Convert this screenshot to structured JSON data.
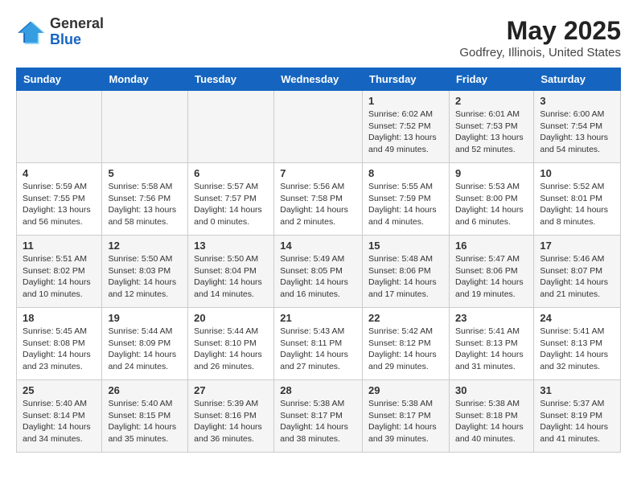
{
  "logo": {
    "general": "General",
    "blue": "Blue"
  },
  "title": "May 2025",
  "subtitle": "Godfrey, Illinois, United States",
  "days_of_week": [
    "Sunday",
    "Monday",
    "Tuesday",
    "Wednesday",
    "Thursday",
    "Friday",
    "Saturday"
  ],
  "weeks": [
    [
      {
        "num": "",
        "info": ""
      },
      {
        "num": "",
        "info": ""
      },
      {
        "num": "",
        "info": ""
      },
      {
        "num": "",
        "info": ""
      },
      {
        "num": "1",
        "info": "Sunrise: 6:02 AM\nSunset: 7:52 PM\nDaylight: 13 hours\nand 49 minutes."
      },
      {
        "num": "2",
        "info": "Sunrise: 6:01 AM\nSunset: 7:53 PM\nDaylight: 13 hours\nand 52 minutes."
      },
      {
        "num": "3",
        "info": "Sunrise: 6:00 AM\nSunset: 7:54 PM\nDaylight: 13 hours\nand 54 minutes."
      }
    ],
    [
      {
        "num": "4",
        "info": "Sunrise: 5:59 AM\nSunset: 7:55 PM\nDaylight: 13 hours\nand 56 minutes."
      },
      {
        "num": "5",
        "info": "Sunrise: 5:58 AM\nSunset: 7:56 PM\nDaylight: 13 hours\nand 58 minutes."
      },
      {
        "num": "6",
        "info": "Sunrise: 5:57 AM\nSunset: 7:57 PM\nDaylight: 14 hours\nand 0 minutes."
      },
      {
        "num": "7",
        "info": "Sunrise: 5:56 AM\nSunset: 7:58 PM\nDaylight: 14 hours\nand 2 minutes."
      },
      {
        "num": "8",
        "info": "Sunrise: 5:55 AM\nSunset: 7:59 PM\nDaylight: 14 hours\nand 4 minutes."
      },
      {
        "num": "9",
        "info": "Sunrise: 5:53 AM\nSunset: 8:00 PM\nDaylight: 14 hours\nand 6 minutes."
      },
      {
        "num": "10",
        "info": "Sunrise: 5:52 AM\nSunset: 8:01 PM\nDaylight: 14 hours\nand 8 minutes."
      }
    ],
    [
      {
        "num": "11",
        "info": "Sunrise: 5:51 AM\nSunset: 8:02 PM\nDaylight: 14 hours\nand 10 minutes."
      },
      {
        "num": "12",
        "info": "Sunrise: 5:50 AM\nSunset: 8:03 PM\nDaylight: 14 hours\nand 12 minutes."
      },
      {
        "num": "13",
        "info": "Sunrise: 5:50 AM\nSunset: 8:04 PM\nDaylight: 14 hours\nand 14 minutes."
      },
      {
        "num": "14",
        "info": "Sunrise: 5:49 AM\nSunset: 8:05 PM\nDaylight: 14 hours\nand 16 minutes."
      },
      {
        "num": "15",
        "info": "Sunrise: 5:48 AM\nSunset: 8:06 PM\nDaylight: 14 hours\nand 17 minutes."
      },
      {
        "num": "16",
        "info": "Sunrise: 5:47 AM\nSunset: 8:06 PM\nDaylight: 14 hours\nand 19 minutes."
      },
      {
        "num": "17",
        "info": "Sunrise: 5:46 AM\nSunset: 8:07 PM\nDaylight: 14 hours\nand 21 minutes."
      }
    ],
    [
      {
        "num": "18",
        "info": "Sunrise: 5:45 AM\nSunset: 8:08 PM\nDaylight: 14 hours\nand 23 minutes."
      },
      {
        "num": "19",
        "info": "Sunrise: 5:44 AM\nSunset: 8:09 PM\nDaylight: 14 hours\nand 24 minutes."
      },
      {
        "num": "20",
        "info": "Sunrise: 5:44 AM\nSunset: 8:10 PM\nDaylight: 14 hours\nand 26 minutes."
      },
      {
        "num": "21",
        "info": "Sunrise: 5:43 AM\nSunset: 8:11 PM\nDaylight: 14 hours\nand 27 minutes."
      },
      {
        "num": "22",
        "info": "Sunrise: 5:42 AM\nSunset: 8:12 PM\nDaylight: 14 hours\nand 29 minutes."
      },
      {
        "num": "23",
        "info": "Sunrise: 5:41 AM\nSunset: 8:13 PM\nDaylight: 14 hours\nand 31 minutes."
      },
      {
        "num": "24",
        "info": "Sunrise: 5:41 AM\nSunset: 8:13 PM\nDaylight: 14 hours\nand 32 minutes."
      }
    ],
    [
      {
        "num": "25",
        "info": "Sunrise: 5:40 AM\nSunset: 8:14 PM\nDaylight: 14 hours\nand 34 minutes."
      },
      {
        "num": "26",
        "info": "Sunrise: 5:40 AM\nSunset: 8:15 PM\nDaylight: 14 hours\nand 35 minutes."
      },
      {
        "num": "27",
        "info": "Sunrise: 5:39 AM\nSunset: 8:16 PM\nDaylight: 14 hours\nand 36 minutes."
      },
      {
        "num": "28",
        "info": "Sunrise: 5:38 AM\nSunset: 8:17 PM\nDaylight: 14 hours\nand 38 minutes."
      },
      {
        "num": "29",
        "info": "Sunrise: 5:38 AM\nSunset: 8:17 PM\nDaylight: 14 hours\nand 39 minutes."
      },
      {
        "num": "30",
        "info": "Sunrise: 5:38 AM\nSunset: 8:18 PM\nDaylight: 14 hours\nand 40 minutes."
      },
      {
        "num": "31",
        "info": "Sunrise: 5:37 AM\nSunset: 8:19 PM\nDaylight: 14 hours\nand 41 minutes."
      }
    ]
  ]
}
